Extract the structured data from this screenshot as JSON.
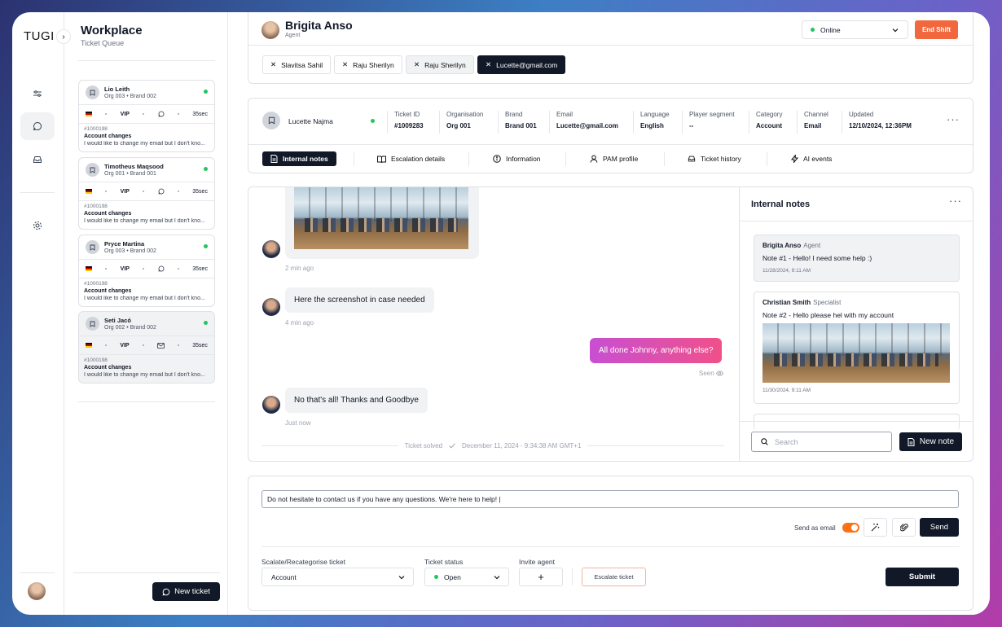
{
  "app": {
    "logo": "TUGI"
  },
  "queue": {
    "title": "Workplace",
    "subtitle": "Ticket Queue",
    "tickets": [
      {
        "name": "Lio Leith",
        "org": "Org 003",
        "brand": "Brand 002",
        "vip": "VIP",
        "wait": "35sec",
        "id": "#1000198",
        "subject": "Account changes",
        "preview": "I would like to change my email but I don't kno..."
      },
      {
        "name": "Timotheus Maqsood",
        "org": "Org 001",
        "brand": "Brand 001",
        "vip": "VIP",
        "wait": "35sec",
        "id": "#1000198",
        "subject": "Account changes",
        "preview": "I would like to change my email but I don't kno..."
      },
      {
        "name": "Pryce Martina",
        "org": "Org 003",
        "brand": "Brand 002",
        "vip": "VIP",
        "wait": "35sec",
        "id": "#1000198",
        "subject": "Account changes",
        "preview": "I would like to change my email but I don't kno..."
      },
      {
        "name": "Seti Jacó",
        "org": "Org 002",
        "brand": "Brand 002",
        "vip": "VIP",
        "wait": "35sec",
        "id": "#1000198",
        "subject": "Account changes",
        "preview": "I would like to change my email but I don't kno..."
      }
    ],
    "new_ticket": "New ticket"
  },
  "header": {
    "agent_name": "Brigita Anso",
    "agent_role": "Agent",
    "status": "Online",
    "end_shift": "End Shift",
    "tabs": [
      "Slavitsa Sahil",
      "Raju Sherilyn",
      "Raju Sherilyn",
      "Lucette@gmail.com"
    ]
  },
  "ticket": {
    "customer": "Lucette Najma",
    "fields": [
      {
        "label": "Ticket ID",
        "value": "#1009283"
      },
      {
        "label": "Organisation",
        "value": "Org 001"
      },
      {
        "label": "Brand",
        "value": "Brand 001"
      },
      {
        "label": "Email",
        "value": "Lucette@gmail.com"
      },
      {
        "label": "Language",
        "value": "English"
      },
      {
        "label": "Player segment",
        "value": "--"
      },
      {
        "label": "Category",
        "value": "Account"
      },
      {
        "label": "Channel",
        "value": "Email"
      },
      {
        "label": "Updated",
        "value": "12/10/2024, 12:36PM"
      }
    ],
    "subtabs": [
      "Internal notes",
      "Escalation details",
      "Information",
      "PAM profile",
      "Ticket history",
      "AI events"
    ]
  },
  "chat": {
    "messages": [
      {
        "text": "",
        "time": "2 min ago"
      },
      {
        "text": "Here the screenshot in case needed",
        "time": "4 min ago"
      },
      {
        "text": "All done Johnny, anything else?",
        "time": "Seen"
      },
      {
        "text": "No that's all! Thanks and Goodbye",
        "time": "Just now"
      }
    ],
    "solved": "Ticket solved",
    "solved_time": "December 11, 2024 - 9:34:38 AM GMT+1"
  },
  "notes": {
    "title": "Internal notes",
    "items": [
      {
        "author": "Brigita Anso",
        "role": "Agent",
        "text": "Note #1 - Hello! I need some help :)",
        "time": "11/28/2024, 9:11 AM"
      },
      {
        "author": "Christian Smith",
        "role": "Specialist",
        "text": "Note #2 - Hello please hel with my account",
        "time": "11/30/2024, 9:11 AM"
      }
    ],
    "search_placeholder": "Search",
    "new_note": "New note"
  },
  "composer": {
    "message": "Do not hesitate to contact us if you have any questions. We're here to help! |",
    "send_as_email": "Send as email",
    "send_as_email_on": true,
    "send": "Send",
    "escalate_label": "Scalate/Recategorise ticket",
    "escalate_value": "Account",
    "status_label": "Ticket status",
    "status_value": "Open",
    "invite_label": "Invite agent",
    "invite_btn": "+",
    "escalate_btn": "Escalate ticket",
    "submit": "Submit"
  },
  "colors": {
    "accent": "#f2683e",
    "dark": "#111827",
    "online": "#22c55e",
    "toggle": "#f97316"
  }
}
